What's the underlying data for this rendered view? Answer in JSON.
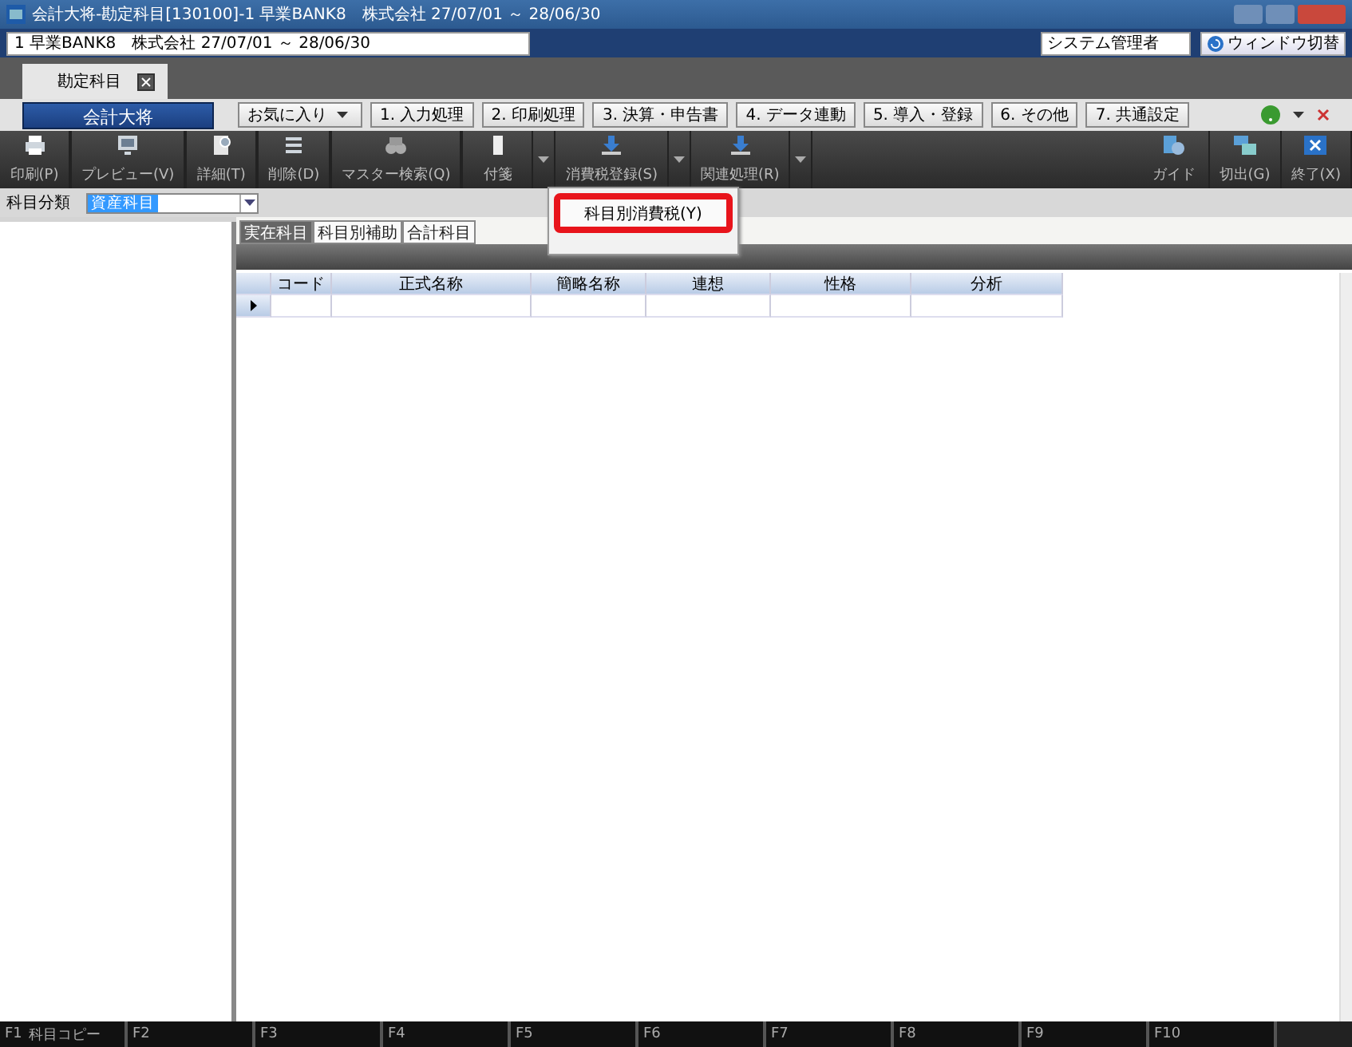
{
  "window": {
    "title": "会計大将-勘定科目[130100]-1 早業BANK8　株式会社 27/07/01 ～ 28/06/30"
  },
  "company_bar": {
    "company": "1 早業BANK8　株式会社 27/07/01 ～ 28/06/30",
    "user": "システム管理者",
    "window_switch": "ウィンドウ切替"
  },
  "doc_tabs": [
    {
      "label": "勘定科目",
      "selected": true
    }
  ],
  "menu_bar": {
    "app": "会計大将",
    "favorites": "お気に入り",
    "items": [
      "1. 入力処理",
      "2. 印刷処理",
      "3. 決算・申告書",
      "4. データ連動",
      "5. 導入・登録",
      "6. その他",
      "7. 共通設定"
    ]
  },
  "toolbar": {
    "left": [
      {
        "label": "印刷(P)",
        "kind": "printer",
        "dropdown": false
      },
      {
        "label": "プレビュー(V)",
        "kind": "monitor",
        "dropdown": false
      },
      {
        "label": "詳細(T)",
        "kind": "detail",
        "dropdown": false
      },
      {
        "label": "削除(D)",
        "kind": "delete",
        "dropdown": false
      },
      {
        "label": "マスター検索(Q)",
        "kind": "search",
        "dropdown": false
      },
      {
        "label": "付箋",
        "kind": "note",
        "dropdown": true
      },
      {
        "label": "消費税登録(S)",
        "kind": "download",
        "dropdown": true
      },
      {
        "label": "関連処理(R)",
        "kind": "download",
        "dropdown": true
      }
    ],
    "right": [
      {
        "label": "ガイド",
        "kind": "guide"
      },
      {
        "label": "切出(G)",
        "kind": "windows"
      },
      {
        "label": "終了(X)",
        "kind": "close"
      }
    ]
  },
  "filter": {
    "label": "科目分類",
    "value": "資産科目"
  },
  "sub_tabs": [
    {
      "label": "実在科目",
      "selected": true
    },
    {
      "label": "科目別補助",
      "selected": false
    },
    {
      "label": "合計科目",
      "selected": false
    }
  ],
  "table": {
    "columns": [
      "コード",
      "正式名称",
      "簡略名称",
      "連想",
      "性格",
      "分析"
    ]
  },
  "dropdown_menu": [
    {
      "label": "科目別消費税(Y)",
      "selected": true
    }
  ],
  "function_keys": [
    {
      "key": "F1",
      "label": "科目コピー"
    },
    {
      "key": "F2"
    },
    {
      "key": "F3"
    },
    {
      "key": "F4"
    },
    {
      "key": "F5"
    },
    {
      "key": "F6"
    },
    {
      "key": "F7"
    },
    {
      "key": "F8"
    },
    {
      "key": "F9"
    },
    {
      "key": "F10"
    }
  ]
}
